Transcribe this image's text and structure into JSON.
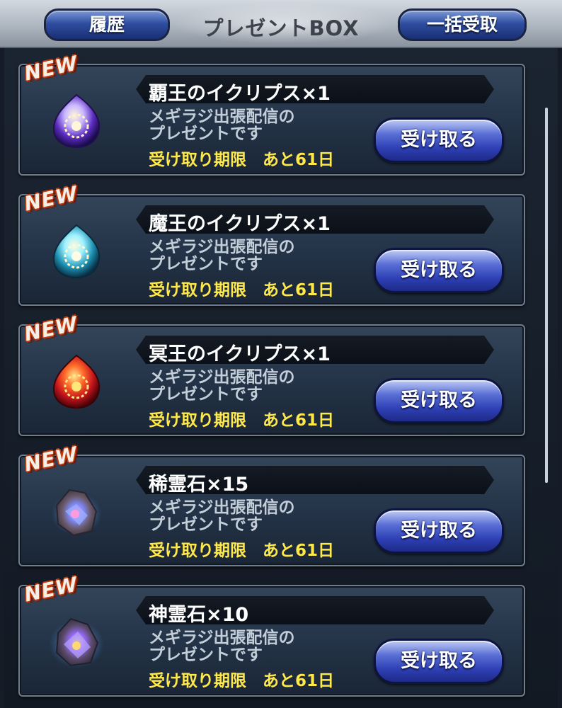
{
  "header": {
    "title": "プレゼントBOX",
    "history_label": "履歴",
    "receive_all_label": "一括受取"
  },
  "colors": {
    "deadline_text": "#ffe94a",
    "button_blue": "#2d3fb4",
    "new_badge_outline": "#c23a0e"
  },
  "items": [
    {
      "badge": "NEW",
      "name": "覇王のイクリプス×1",
      "desc_line1": "メギラジ出張配信の",
      "desc_line2": "プレゼントです",
      "deadline": "受け取り期限　あと61日",
      "button": "受け取る",
      "icon": "eclipse-gem-purple-icon"
    },
    {
      "badge": "NEW",
      "name": "魔王のイクリプス×1",
      "desc_line1": "メギラジ出張配信の",
      "desc_line2": "プレゼントです",
      "deadline": "受け取り期限　あと61日",
      "button": "受け取る",
      "icon": "eclipse-gem-cyan-icon"
    },
    {
      "badge": "NEW",
      "name": "冥王のイクリプス×1",
      "desc_line1": "メギラジ出張配信の",
      "desc_line2": "プレゼントです",
      "deadline": "受け取り期限　あと61日",
      "button": "受け取る",
      "icon": "eclipse-gem-red-icon"
    },
    {
      "badge": "NEW",
      "name": "稀霊石×15",
      "desc_line1": "メギラジ出張配信の",
      "desc_line2": "プレゼントです",
      "deadline": "受け取り期限　あと61日",
      "button": "受け取る",
      "icon": "rare-spirit-stone-icon"
    },
    {
      "badge": "NEW",
      "name": "神霊石×10",
      "desc_line1": "メギラジ出張配信の",
      "desc_line2": "プレゼントです",
      "deadline": "受け取り期限　あと61日",
      "button": "受け取る",
      "icon": "divine-spirit-stone-icon"
    }
  ]
}
